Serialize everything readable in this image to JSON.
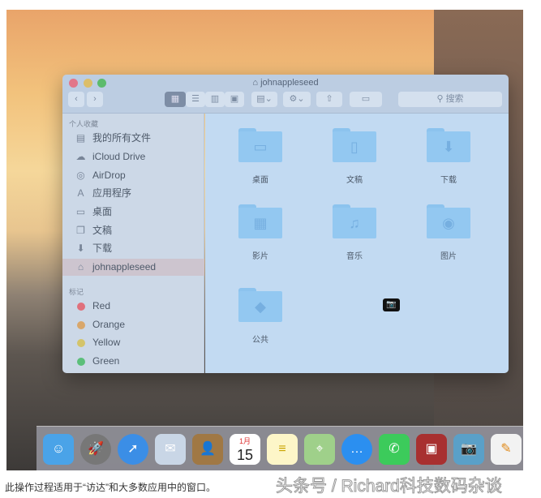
{
  "window": {
    "title": "johnappleseed",
    "search_placeholder": "搜索"
  },
  "sidebar": {
    "favorites_header": "个人收藏",
    "favorites": [
      {
        "label": "我的所有文件",
        "icon": "all-files-icon"
      },
      {
        "label": "iCloud Drive",
        "icon": "cloud-icon"
      },
      {
        "label": "AirDrop",
        "icon": "airdrop-icon"
      },
      {
        "label": "应用程序",
        "icon": "applications-icon"
      },
      {
        "label": "桌面",
        "icon": "desktop-icon"
      },
      {
        "label": "文稿",
        "icon": "documents-icon"
      },
      {
        "label": "下载",
        "icon": "download-icon"
      },
      {
        "label": "johnappleseed",
        "icon": "home-icon"
      }
    ],
    "tags_header": "标记",
    "tags": [
      {
        "label": "Red",
        "color": "#e0707c"
      },
      {
        "label": "Orange",
        "color": "#d9a76b"
      },
      {
        "label": "Yellow",
        "color": "#d4c46a"
      },
      {
        "label": "Green",
        "color": "#5cbf7a"
      }
    ]
  },
  "folders": [
    {
      "label": "桌面",
      "glyph": "▭"
    },
    {
      "label": "文稿",
      "glyph": "▯"
    },
    {
      "label": "下载",
      "glyph": "⬇"
    },
    {
      "label": "影片",
      "glyph": "▦"
    },
    {
      "label": "音乐",
      "glyph": "♫"
    },
    {
      "label": "图片",
      "glyph": "◉"
    },
    {
      "label": "公共",
      "glyph": "◆"
    }
  ],
  "dock": {
    "calendar_month": "1月",
    "calendar_day": "15"
  },
  "caption": "此操作过程适用于“访达”和大多数应用中的窗口。",
  "watermark": "头条号 / Richard科技数码杂谈"
}
